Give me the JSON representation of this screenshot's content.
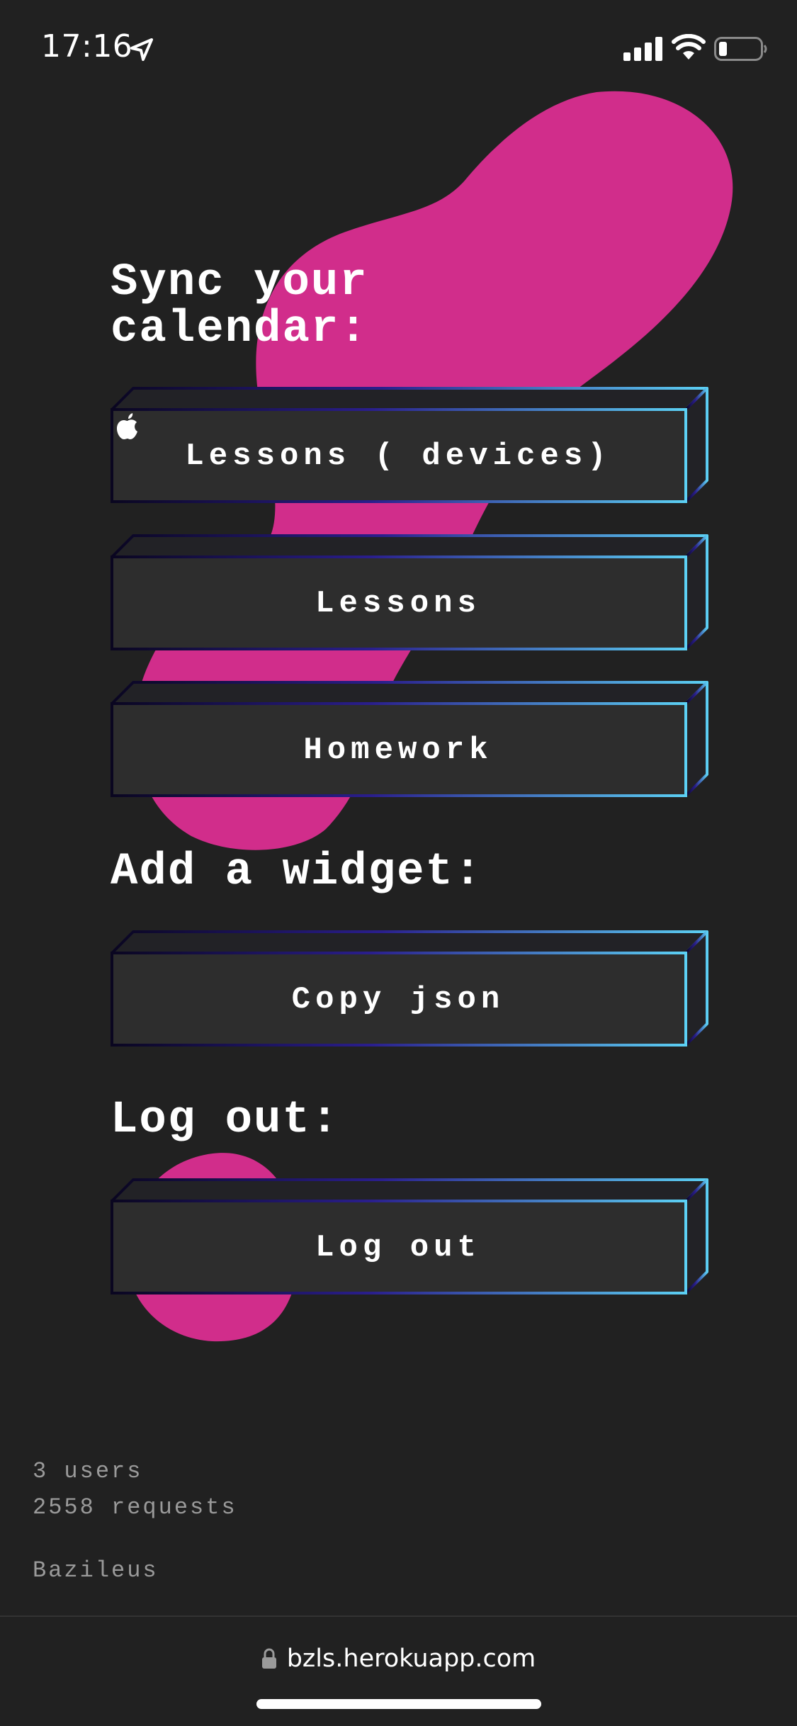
{
  "status_bar": {
    "time": "17:16",
    "location_icon": "location-arrow-icon",
    "signal_icon": "cellular-signal-icon",
    "wifi_icon": "wifi-icon",
    "battery_icon": "battery-low-icon"
  },
  "colors": {
    "background": "#212121",
    "blob": "#D12D8B",
    "button_face": "#2D2D2D",
    "gradient_start": "#0A0620",
    "gradient_mid": "#2A1E8C",
    "gradient_end": "#5CD0F4"
  },
  "sync_section": {
    "title_line1": "Sync your",
    "title_line2": "calendar:",
    "buttons": [
      {
        "label_before": "Lessons (",
        "icon": "apple-logo-icon",
        "label_after": " devices)"
      },
      {
        "label": "Lessons"
      },
      {
        "label": "Homework"
      }
    ]
  },
  "widget_section": {
    "title": "Add a widget:",
    "button_label": "Copy json"
  },
  "logout_section": {
    "title": "Log out:",
    "button_label": "Log out"
  },
  "stats": {
    "users": "3 users",
    "requests": "2558 requests",
    "author": "Bazileus"
  },
  "browser": {
    "lock_icon": "lock-icon",
    "url": "bzls.herokuapp.com"
  }
}
